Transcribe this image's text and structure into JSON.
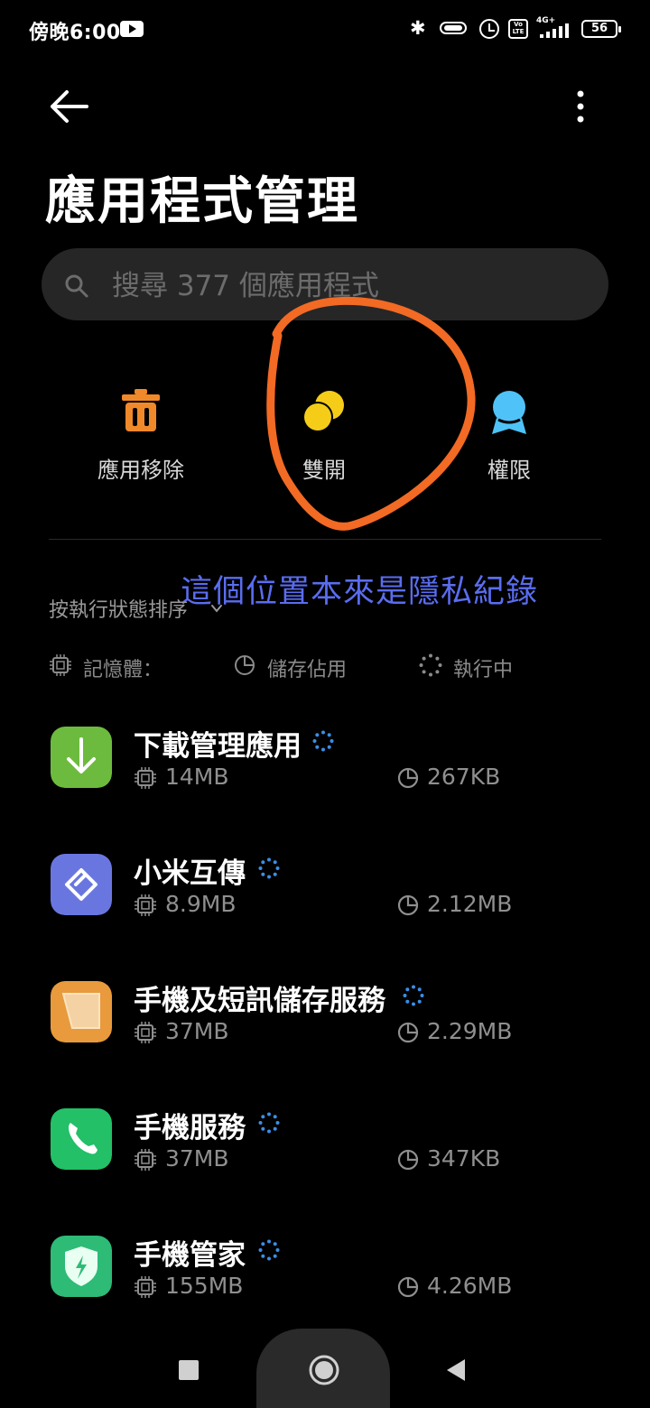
{
  "status_bar": {
    "time": "傍晚6:00",
    "network": "4G+",
    "battery": "56"
  },
  "header": {
    "title": "應用程式管理"
  },
  "search": {
    "placeholder": "搜尋 377 個應用程式"
  },
  "quick_actions": [
    {
      "label": "應用移除",
      "icon": "trash-icon",
      "color": "#f0892a"
    },
    {
      "label": "雙開",
      "icon": "dual-apps-icon",
      "color": "#f5cd18"
    },
    {
      "label": "權限",
      "icon": "permissions-icon",
      "color": "#4fc3f7"
    }
  ],
  "annotation": "這個位置本來是隱私紀錄",
  "sort": {
    "label": "按執行狀態排序"
  },
  "legend": {
    "memory": "記憶體：",
    "storage": "儲存佔用",
    "running": "執行中"
  },
  "apps": [
    {
      "name": "下載管理應用",
      "memory": "14MB",
      "storage": "267KB",
      "icon": "download-icon",
      "color": "#6dbb3e"
    },
    {
      "name": "小米互傳",
      "memory": "8.9MB",
      "storage": "2.12MB",
      "icon": "mi-share-icon",
      "color": "#6a76e0"
    },
    {
      "name": "手機及短訊儲存服務",
      "memory": "37MB",
      "storage": "2.29MB",
      "icon": "message-storage-icon",
      "color": "#e89a3c"
    },
    {
      "name": "手機服務",
      "memory": "37MB",
      "storage": "347KB",
      "icon": "phone-icon",
      "color": "#23c067"
    },
    {
      "name": "手機管家",
      "memory": "155MB",
      "storage": "4.26MB",
      "icon": "security-shield-icon",
      "color": "#2dbb76"
    }
  ],
  "colors": {
    "annotation_circle": "#f26a24",
    "running_indicator": "#3a8ee6"
  }
}
